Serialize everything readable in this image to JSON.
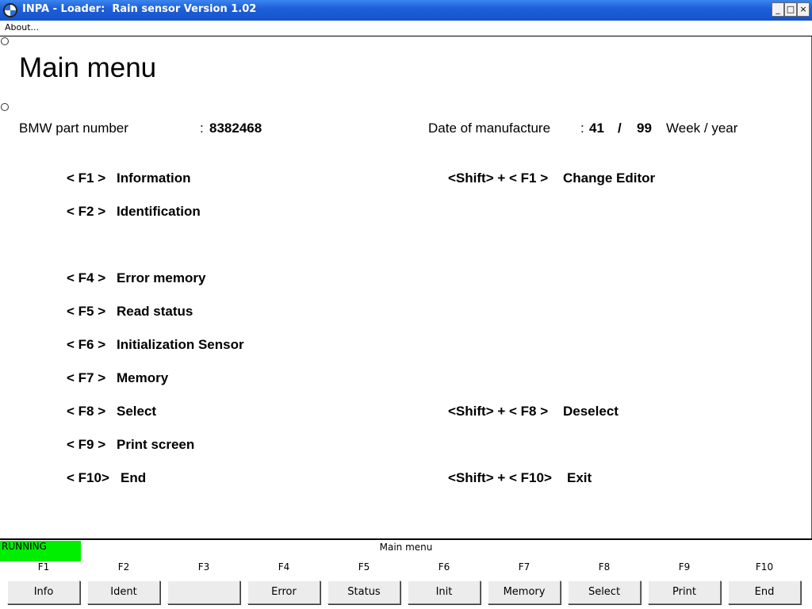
{
  "window": {
    "title": "INPA - Loader:  Rain sensor Version 1.02",
    "controls": {
      "minimize": "_",
      "maximize": "□",
      "close": "×"
    }
  },
  "menubar": {
    "about": "About..."
  },
  "main": {
    "title": "Main menu",
    "part_number_label": "BMW part number",
    "part_number_sep": ":",
    "part_number_value": "8382468",
    "date_label": "Date of manufacture",
    "date_sep": ":",
    "date_week": "41",
    "date_slash": "/",
    "date_year": "99",
    "date_unit": "Week / year",
    "left_menu": [
      {
        "key": "< F1 >",
        "label": "Information"
      },
      {
        "key": "< F2 >",
        "label": "Identification"
      },
      {
        "key": "< F4 >",
        "label": "Error memory"
      },
      {
        "key": "< F5 >",
        "label": "Read status"
      },
      {
        "key": "< F6 >",
        "label": "Initialization Sensor"
      },
      {
        "key": "< F7 >",
        "label": "Memory"
      },
      {
        "key": "< F8 >",
        "label": "Select"
      },
      {
        "key": "< F9 >",
        "label": "Print screen"
      },
      {
        "key": "< F10>",
        "label": "End"
      }
    ],
    "right_menu": [
      {
        "key": "<Shift> + < F1 >",
        "label": "Change Editor"
      },
      {
        "key": "<Shift> + < F8 >",
        "label": "Deselect"
      },
      {
        "key": "<Shift> + < F10>",
        "label": "Exit"
      }
    ]
  },
  "statusbar": {
    "state": "RUNNING",
    "state_color": "#00ee00",
    "title": "Main menu",
    "keys": [
      {
        "key": "F1",
        "label": "Info"
      },
      {
        "key": "F2",
        "label": "Ident"
      },
      {
        "key": "F3",
        "label": ""
      },
      {
        "key": "F4",
        "label": "Error"
      },
      {
        "key": "F5",
        "label": "Status"
      },
      {
        "key": "F6",
        "label": "Init"
      },
      {
        "key": "F7",
        "label": "Memory"
      },
      {
        "key": "F8",
        "label": "Select"
      },
      {
        "key": "F9",
        "label": "Print"
      },
      {
        "key": "F10",
        "label": "End"
      }
    ]
  }
}
